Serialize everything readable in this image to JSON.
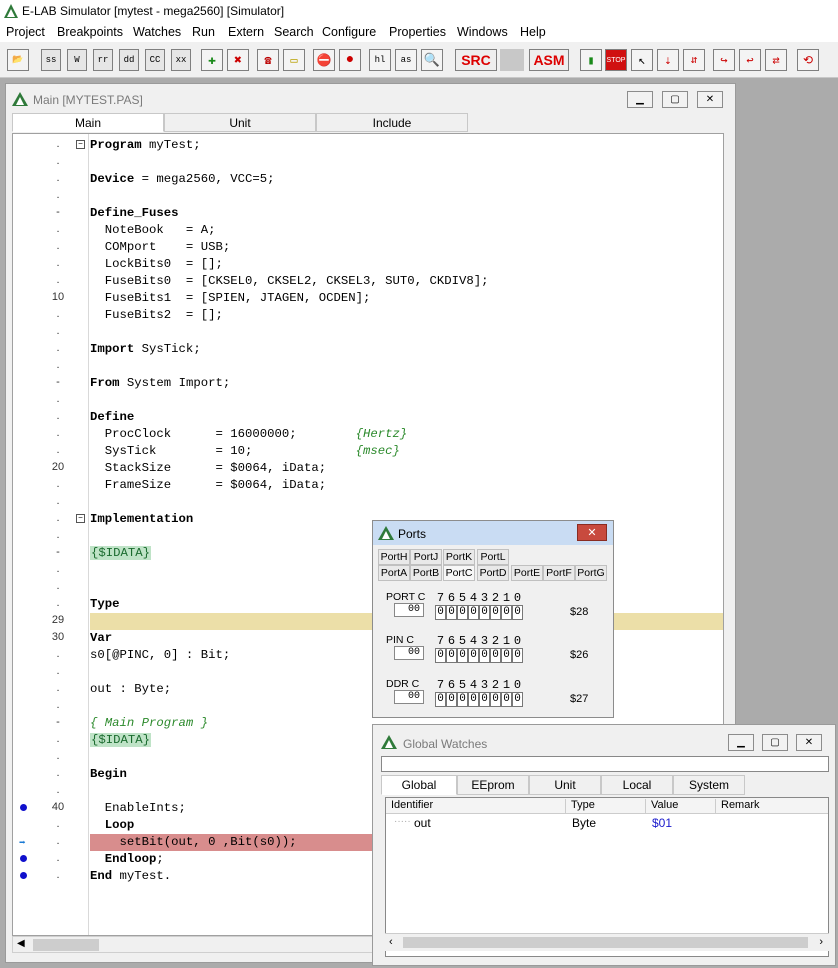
{
  "app": {
    "title": "E-LAB Simulator [mytest - mega2560] [Simulator]"
  },
  "menu": [
    "Project",
    "Breakpoints",
    "Watches",
    "Run",
    "Extern",
    "Search",
    "Configure",
    "Properties",
    "Windows",
    "Help"
  ],
  "toolbar": {
    "ss": "ss",
    "w": "W",
    "rr": "rr",
    "dd": "dd",
    "cc": "CC",
    "xx": "xx",
    "hl": "hl",
    "as": "as",
    "src": "SRC",
    "asm": "ASM",
    "stop": "STOP"
  },
  "main": {
    "title": "Main [MYTEST.PAS]",
    "tabs": [
      "Main",
      "Unit",
      "Include"
    ]
  },
  "lines": [
    {
      "g": ".",
      "t": "Program myTest;",
      "fold": true
    },
    {
      "g": ".",
      "t": ""
    },
    {
      "g": ".",
      "t": "Device = mega2560, VCC=5;"
    },
    {
      "g": ".",
      "t": ""
    },
    {
      "g": "-",
      "t": "Define_Fuses"
    },
    {
      "g": ".",
      "t": "  NoteBook   = A;"
    },
    {
      "g": ".",
      "t": "  COMport    = USB;"
    },
    {
      "g": ".",
      "t": "  LockBits0  = [];"
    },
    {
      "g": ".",
      "t": "  FuseBits0  = [CKSEL0, CKSEL2, CKSEL3, SUT0, CKDIV8];"
    },
    {
      "g": "10",
      "t": "  FuseBits1  = [SPIEN, JTAGEN, OCDEN];"
    },
    {
      "g": ".",
      "t": "  FuseBits2  = [];"
    },
    {
      "g": ".",
      "t": ""
    },
    {
      "g": ".",
      "t": "Import SysTick;"
    },
    {
      "g": ".",
      "t": ""
    },
    {
      "g": "-",
      "t": "From System Import;"
    },
    {
      "g": ".",
      "t": ""
    },
    {
      "g": ".",
      "t": "Define"
    },
    {
      "g": ".",
      "t": "  ProcClock      = 16000000;        ",
      "c": "{Hertz}"
    },
    {
      "g": ".",
      "t": "  SysTick        = 10;              ",
      "c": "{msec}"
    },
    {
      "g": "20",
      "t": "  StackSize      = $0064, iData;"
    },
    {
      "g": ".",
      "t": "  FrameSize      = $0064, iData;"
    },
    {
      "g": ".",
      "t": ""
    },
    {
      "g": ".",
      "t": "Implementation",
      "fold": true
    },
    {
      "g": ".",
      "t": ""
    },
    {
      "g": "-",
      "t": "",
      "d": "{$IDATA}"
    },
    {
      "g": ".",
      "t": ""
    },
    {
      "g": ".",
      "t": ""
    },
    {
      "g": ".",
      "t": "Type"
    },
    {
      "g": "29",
      "t": "",
      "hl": true
    },
    {
      "g": "30",
      "t": "Var"
    },
    {
      "g": ".",
      "t": "s0[@PINC, 0] : Bit;"
    },
    {
      "g": ".",
      "t": ""
    },
    {
      "g": ".",
      "t": "out : Byte;"
    },
    {
      "g": ".",
      "t": ""
    },
    {
      "g": "-",
      "t": "",
      "c": "{ Main Program }"
    },
    {
      "g": ".",
      "t": "",
      "d": "{$IDATA}"
    },
    {
      "g": ".",
      "t": ""
    },
    {
      "g": ".",
      "t": "Begin"
    },
    {
      "g": ".",
      "t": ""
    },
    {
      "g": "40",
      "t": "  EnableInts;",
      "bp": true
    },
    {
      "g": ".",
      "t": "  Loop"
    },
    {
      "g": ".",
      "t": "    setBit(out, 0 ,Bit(s0));",
      "exec": true,
      "arrow": true
    },
    {
      "g": ".",
      "t": "  Endloop;",
      "bp": true
    },
    {
      "g": ".",
      "t": "End myTest.",
      "bp": true
    }
  ],
  "ports": {
    "title": "Ports",
    "tabs_row1": [
      "PortH",
      "PortJ",
      "PortK",
      "PortL"
    ],
    "tabs_row2": [
      "PortA",
      "PortB",
      "PortC",
      "PortD",
      "PortE",
      "PortF",
      "PortG"
    ],
    "bits": [
      "7",
      "6",
      "5",
      "4",
      "3",
      "2",
      "1",
      "0"
    ],
    "groups": [
      {
        "label": "PORT C",
        "value": "00",
        "cells": [
          "0",
          "0",
          "0",
          "0",
          "0",
          "0",
          "0",
          "0"
        ],
        "addr": "$28"
      },
      {
        "label": "PIN C",
        "value": "00",
        "cells": [
          "0",
          "0",
          "0",
          "0",
          "0",
          "0",
          "0",
          "0"
        ],
        "addr": "$26"
      },
      {
        "label": "DDR C",
        "value": "00",
        "cells": [
          "0",
          "0",
          "0",
          "0",
          "0",
          "0",
          "0",
          "0"
        ],
        "addr": "$27"
      }
    ]
  },
  "watches": {
    "title": "Global Watches",
    "tabs": [
      "Global",
      "EEprom",
      "Unit",
      "Local",
      "System"
    ],
    "columns": [
      "Identifier",
      "Type",
      "Value",
      "Remark"
    ],
    "rows": [
      {
        "id": "out",
        "type": "Byte",
        "value": "$01",
        "remark": ""
      }
    ]
  },
  "colors": {
    "exec": "#d88d8d",
    "highlight": "#ecdfa8",
    "directive": "#bfe3c7",
    "comment": "#2c8a2c",
    "value": "#1a1acc"
  }
}
